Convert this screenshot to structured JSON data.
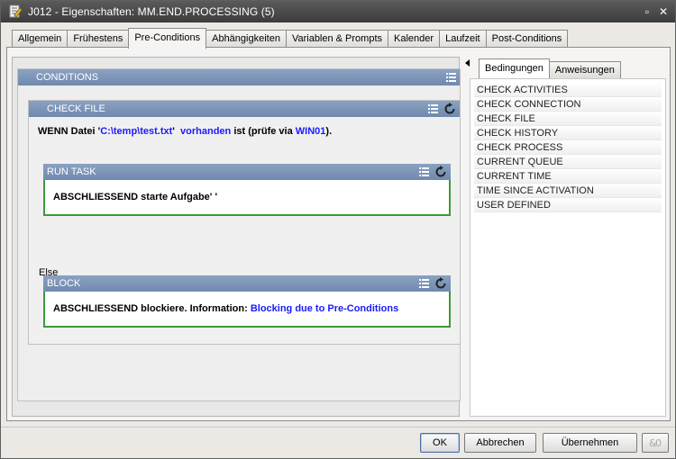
{
  "window": {
    "title": "J012 - Eigenschaften: MM.END.PROCESSING (5)"
  },
  "tabs": [
    {
      "label": "Allgemein"
    },
    {
      "label": "Frühestens"
    },
    {
      "label": "Pre-Conditions"
    },
    {
      "label": "Abhängigkeiten"
    },
    {
      "label": "Variablen & Prompts"
    },
    {
      "label": "Kalender"
    },
    {
      "label": "Laufzeit"
    },
    {
      "label": "Post-Conditions"
    }
  ],
  "editor": {
    "conditions_header": "CONDITIONS",
    "check_header": "CHECK FILE",
    "check_line": {
      "p1": "WENN Datei '",
      "path": "C:\\temp\\test.txt",
      "p2": "'  ",
      "exists": "vorhanden",
      "p3": " ist (prüfe via ",
      "host": "WIN01",
      "p4": ")."
    },
    "run_task": {
      "header": "RUN TASK",
      "text": "ABSCHLIESSEND starte Aufgabe' '"
    },
    "else_label": "Else",
    "block": {
      "header": "BLOCK",
      "text": "ABSCHLIESSEND blockiere. Information: ",
      "info": "Blocking due to Pre-Conditions"
    }
  },
  "right_panel": {
    "tabs": [
      {
        "label": "Bedingungen"
      },
      {
        "label": "Anweisungen"
      }
    ],
    "items": [
      "CHECK ACTIVITIES",
      "CHECK CONNECTION",
      "CHECK FILE",
      "CHECK HISTORY",
      "CHECK PROCESS",
      "CURRENT QUEUE",
      "CURRENT TIME",
      "TIME SINCE ACTIVATION",
      "USER DEFINED"
    ]
  },
  "buttons": {
    "ok": "OK",
    "cancel": "Abbrechen",
    "apply": "Übernehmen"
  },
  "colors": {
    "header_bar": "#7f97b9",
    "box_border": "#3a9b36",
    "link_text": "#1a1aff"
  }
}
